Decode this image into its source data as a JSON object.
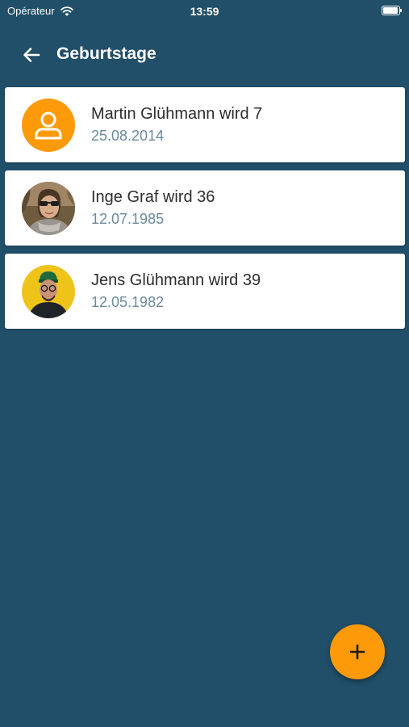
{
  "status_bar": {
    "carrier": "Opérateur",
    "time": "13:59",
    "battery_level": 0.95
  },
  "header": {
    "title": "Geburtstage",
    "back_icon": "arrow-left-icon"
  },
  "birthdays": [
    {
      "title": "Martin Glühmann wird 7",
      "date": "25.08.2014",
      "avatar": "placeholder-person-icon"
    },
    {
      "title": "Inge Graf wird 36",
      "date": "12.07.1985",
      "avatar": "photo"
    },
    {
      "title": "Jens Glühmann wird 39",
      "date": "12.05.1982",
      "avatar": "photo"
    }
  ],
  "fab": {
    "icon": "plus-icon"
  },
  "colors": {
    "background": "#214e68",
    "accent": "#fd9a0a",
    "card": "#ffffff",
    "title_text": "#2d2d2d",
    "date_text": "#6b8a9c"
  }
}
